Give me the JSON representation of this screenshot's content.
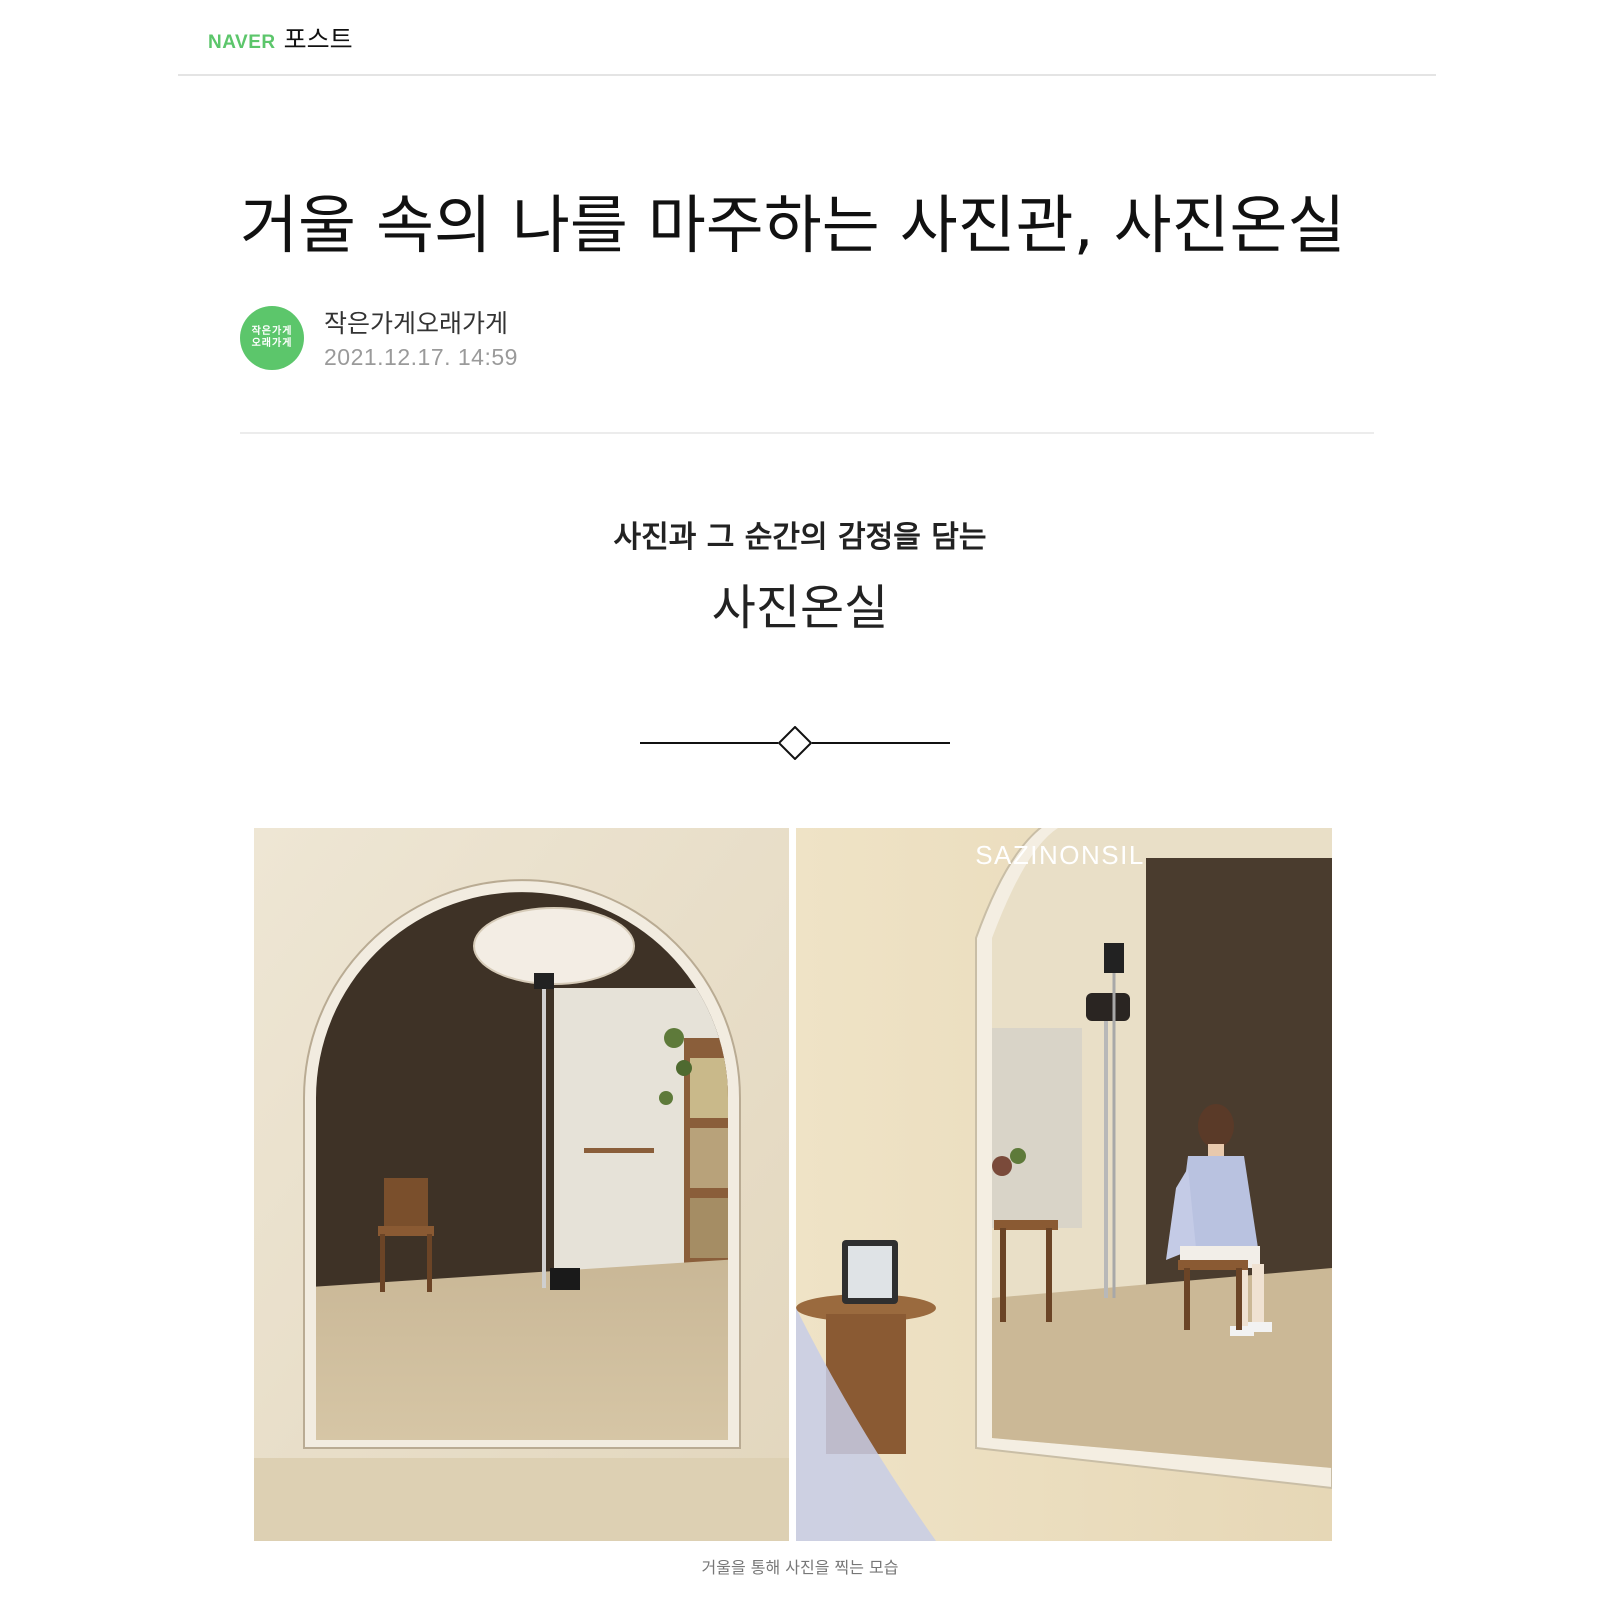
{
  "header": {
    "brand": "NAVER",
    "section": "포스트"
  },
  "article": {
    "title": "거울 속의 나를 마주하는 사진관, 사진온실",
    "author": {
      "name": "작은가게오래가게",
      "avatar_text": "작은가게 오래가게"
    },
    "published": "2021.12.17. 14:59"
  },
  "content": {
    "subheading": "사진과 그 순간의 감정을 담는",
    "brand_name": "사진온실",
    "ornament_icon": "diamond-divider-icon",
    "photo_watermark": "SAZINONSIL",
    "caption": "거울을 통해 사진을 찍는 모습"
  },
  "colors": {
    "naver_green": "#5cc66b",
    "wall": "#e7dcc6",
    "backdrop": "#3e3226",
    "floor": "#cbb896"
  }
}
